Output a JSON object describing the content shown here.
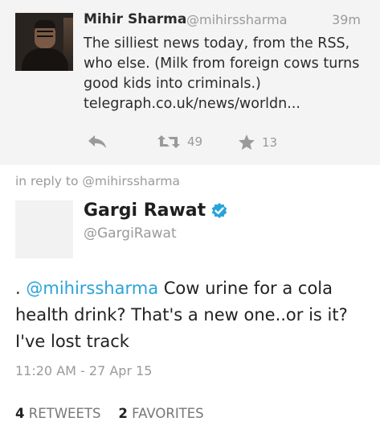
{
  "parent_tweet": {
    "name": "Mihir Sharma",
    "handle": "@mihirssharma",
    "time": "39m",
    "text": "The silliest news today, from the RSS, who else. (Milk from foreign cows turns good kids into criminals.) telegraph.co.uk/news/worldn...",
    "retweet_count": "49",
    "favorite_count": "13"
  },
  "reply_context": "in reply to @mihirssharma",
  "main_tweet": {
    "name": "Gargi Rawat",
    "handle": "@GargiRawat",
    "text_prefix": ". ",
    "mention": "@mihirssharma",
    "text_rest": " Cow urine for a cola health drink? That's a new one..or is it? I've lost track",
    "timestamp": "11:20 AM - 27 Apr 15",
    "retweets_count": "4",
    "retweets_label": "RETWEETS",
    "favorites_count": "2",
    "favorites_label": "FAVORITES"
  },
  "colors": {
    "mention": "#2aa3d8",
    "verified": "#2aa3d8",
    "muted": "#9a9a9a",
    "parent_bg": "#f4f4f4"
  },
  "icons": {
    "reply": "reply-icon",
    "retweet": "retweet-icon",
    "favorite": "star-icon",
    "verified": "verified-badge-icon"
  }
}
